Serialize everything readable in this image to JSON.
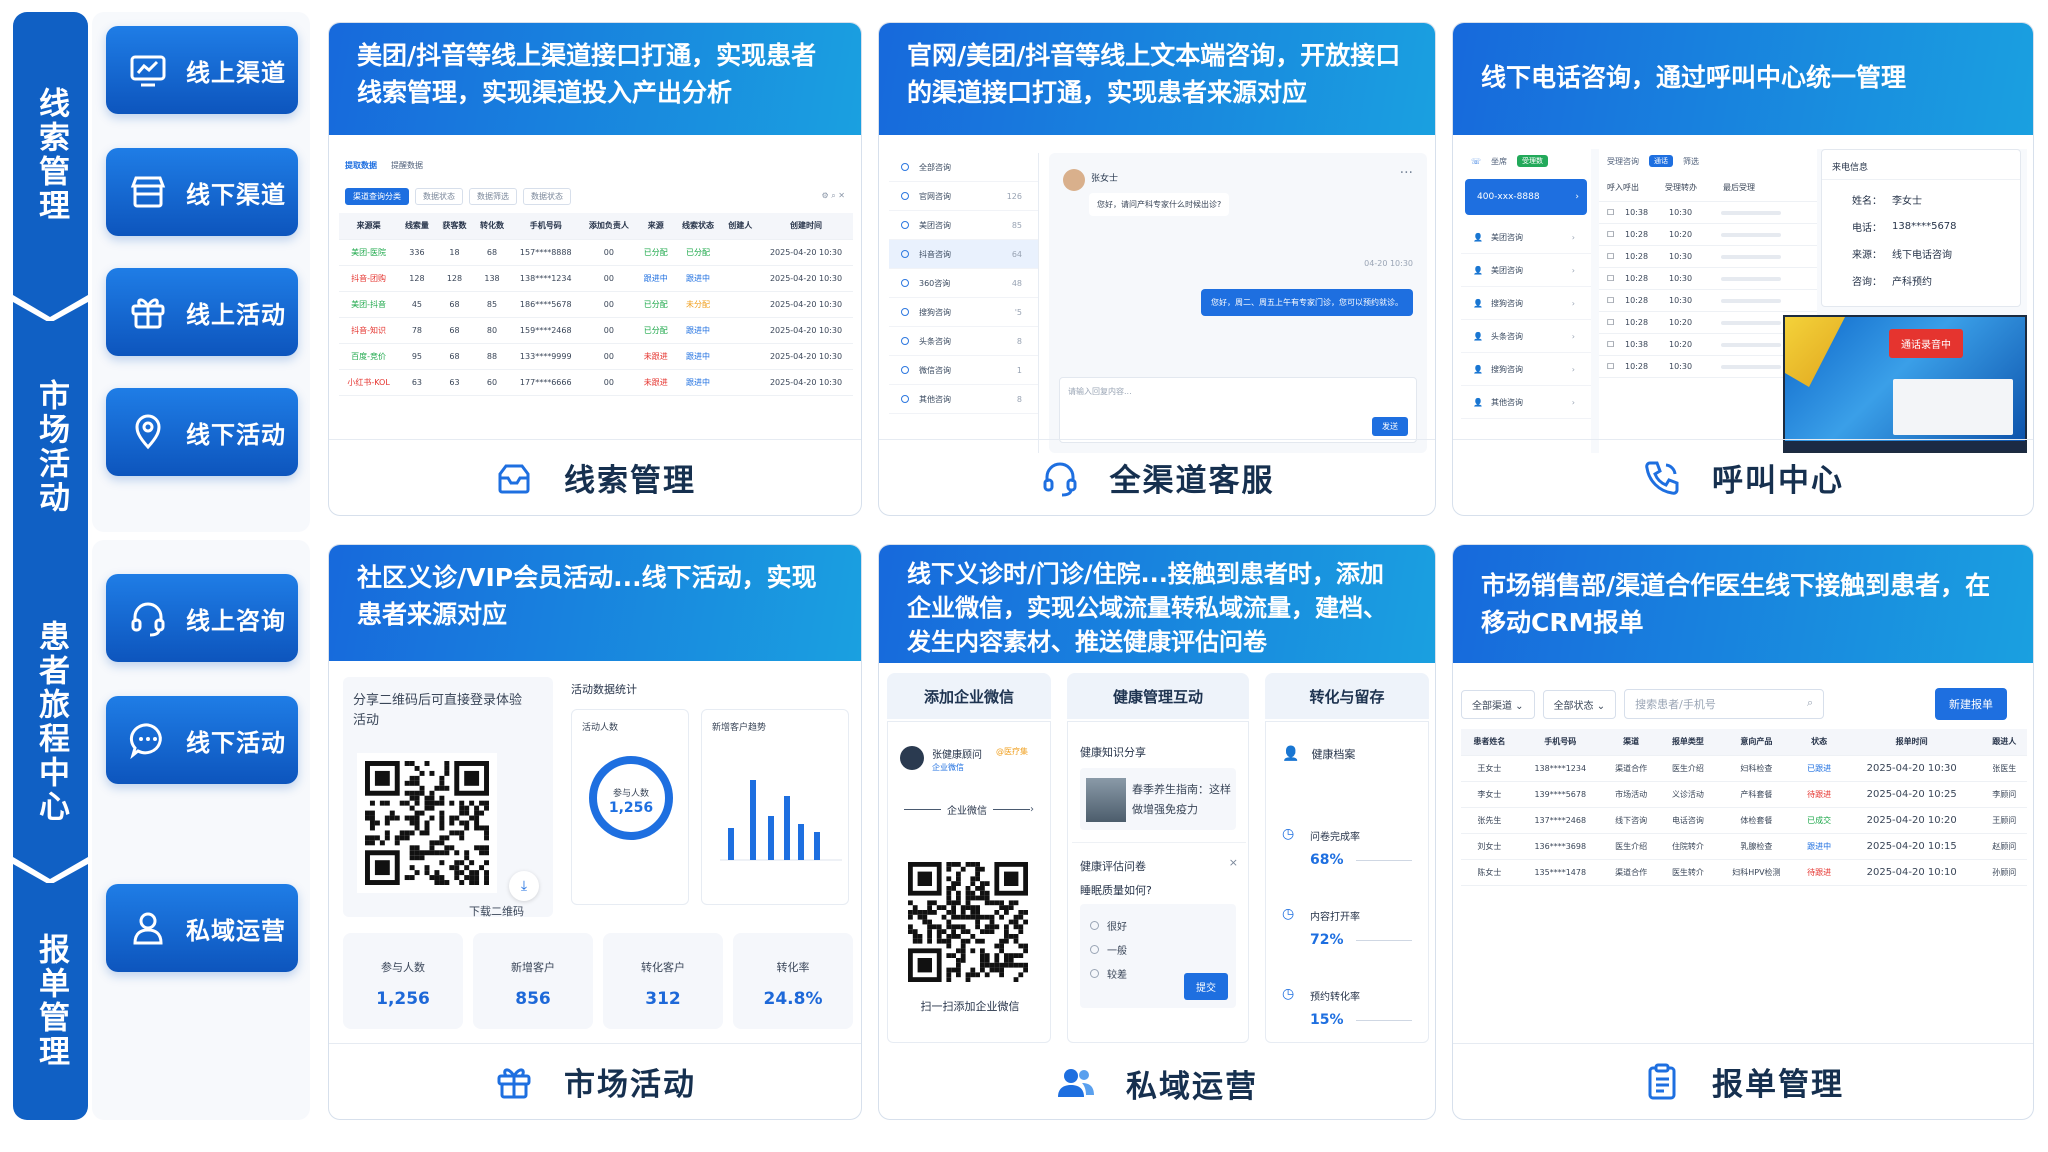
{
  "sidebar": {
    "segments": [
      "线索管理",
      "市场活动",
      "患者旅程中心",
      "报单管理"
    ],
    "items": [
      {
        "label": "线上渠道",
        "icon": "chart-monitor-icon"
      },
      {
        "label": "线下渠道",
        "icon": "store-icon"
      },
      {
        "label": "线上活动",
        "icon": "gift-icon"
      },
      {
        "label": "线下活动",
        "icon": "location-pin-icon"
      },
      {
        "label": "线上咨询",
        "icon": "headset-icon"
      },
      {
        "label": "线下活动",
        "icon": "chat-bubble-icon"
      },
      {
        "label": "私域运营",
        "icon": "user-icon"
      }
    ]
  },
  "cards": {
    "clue": {
      "banner": "美团/抖音等线上渠道接口打通，实现患者线索管理，实现渠道投入产出分析",
      "footer": "线索管理",
      "tabs_top": [
        "提取数据",
        "提醒数据"
      ],
      "filters": [
        "渠道查询分类",
        "数据状态",
        "数据筛选",
        "数据状态"
      ],
      "columns": [
        "来源渠",
        "线索量",
        "获客数",
        "转化数",
        "手机号码",
        "添加负责人",
        "来源",
        "线索状态",
        "创建人",
        "创建时间"
      ],
      "rows": [
        [
          "美团-医院",
          "336",
          "18",
          "68",
          "157****8888",
          "00",
          "已分配",
          "已分配",
          "",
          "2025-04-20 10:30"
        ],
        [
          "抖音-团购",
          "128",
          "128",
          "138",
          "138****1234",
          "00",
          "跟进中",
          "跟进中",
          "",
          "2025-04-20 10:30"
        ],
        [
          "美团-抖音",
          "45",
          "68",
          "85",
          "186****5678",
          "00",
          "已分配",
          "未分配",
          "",
          "2025-04-20 10:30"
        ],
        [
          "抖音-知识",
          "78",
          "68",
          "80",
          "159****2468",
          "00",
          "已分配",
          "跟进中",
          "",
          "2025-04-20 10:30"
        ],
        [
          "百度-竞价",
          "95",
          "68",
          "88",
          "133****9999",
          "00",
          "未跟进",
          "跟进中",
          "",
          "2025-04-20 10:30"
        ],
        [
          "小红书-KOL",
          "63",
          "63",
          "60",
          "177****6666",
          "00",
          "未跟进",
          "跟进中",
          "",
          "2025-04-20 10:30"
        ]
      ]
    },
    "service": {
      "banner": "官网/美团/抖音等线上文本端咨询，开放接口的渠道接口打通，实现患者来源对应",
      "footer": "全渠道客服",
      "list": [
        {
          "name": "全部咨询",
          "count": ""
        },
        {
          "name": "官网咨询",
          "count": "126"
        },
        {
          "name": "美团咨询",
          "count": "85"
        },
        {
          "name": "抖音咨询",
          "count": "64"
        },
        {
          "name": "360咨询",
          "count": "48"
        },
        {
          "name": "搜狗咨询",
          "count": "'5"
        },
        {
          "name": "头条咨询",
          "count": "8"
        },
        {
          "name": "微信咨询",
          "count": "1"
        },
        {
          "name": "其他咨询",
          "count": "8"
        }
      ],
      "chat_name": "张女士",
      "chat_msg1": "您好，请问产科专家什么时候出诊?",
      "chat_time1": "04-20 10:30",
      "chat_msg2": "您好，周二、周五上午有专家门诊，您可以预约就诊。",
      "chat_placeholder": "请输入回复内容...",
      "send": "发送"
    },
    "call": {
      "banner": "线下电话咨询，通过呼叫中心统一管理",
      "footer": "呼叫中心",
      "left_tabs": [
        "坐席",
        "受理数"
      ],
      "line": "400-xxx-8888",
      "side_items": [
        "美团咨询",
        "美团咨询",
        "搜狗咨询",
        "头条咨询",
        "搜狗咨询",
        "其他咨询"
      ],
      "mid_tabs": [
        "受理咨询",
        "通话",
        "筛选"
      ],
      "mid_headers": [
        "呼入呼出",
        "受理转办",
        "最后受理"
      ],
      "mid_rows": [
        [
          "10:38",
          "10:30"
        ],
        [
          "10:28",
          "10:20"
        ],
        [
          "10:28",
          "10:30"
        ],
        [
          "10:28",
          "10:30"
        ],
        [
          "10:28",
          "10:30"
        ],
        [
          "10:28",
          "10:20"
        ],
        [
          "10:38",
          "10:20"
        ],
        [
          "10:28",
          "10:30"
        ]
      ],
      "info_title": "来电信息",
      "info": [
        [
          "姓名：",
          "李女士"
        ],
        [
          "电话：",
          "138****5678"
        ],
        [
          "来源：",
          "线下电话咨询"
        ],
        [
          "咨询：",
          "产科预约"
        ]
      ],
      "record": "通话录音中"
    },
    "activity": {
      "banner": "社区义诊/VIP会员活动...线下活动，实现患者来源对应",
      "footer": "市场活动",
      "share_text": "分享二维码后可直接登录体验活动",
      "download": "下载二维码",
      "stats_title": "活动数据统计",
      "ring_title": "活动人数",
      "ring_label": "参与人数",
      "ring_value": "1,256",
      "trend_title": "新增客户趋势",
      "kpis": [
        {
          "k": "参与人数",
          "v": "1,256"
        },
        {
          "k": "新增客户",
          "v": "856"
        },
        {
          "k": "转化客户",
          "v": "312"
        },
        {
          "k": "转化率",
          "v": "24.8%"
        }
      ]
    },
    "private": {
      "banner": "线下义诊时/门诊/住院...接触到患者时，添加企业微信，实现公域流量转私域流量，建档、发生内容素材、推送健康评估问卷",
      "footer": "私域运营",
      "cols": [
        "添加企业微信",
        "健康管理互动",
        "转化与留存"
      ],
      "wx_name": "张健康顾问",
      "wx_tag": "@医疗集",
      "wx_sub": "企业微信",
      "wx_mid": "企业微信",
      "wx_scan": "扫一扫添加企业微信",
      "knowledge_title": "健康知识分享",
      "knowledge_text": "春季养生指南：这样做增强免疫力",
      "survey_title": "健康评估问卷",
      "survey_q": "睡眠质量如何?",
      "survey_opts": [
        "很好",
        "一般",
        "较差"
      ],
      "survey_submit": "提交",
      "record": "健康档案",
      "metrics": [
        {
          "k": "问卷完成率",
          "v": "68%"
        },
        {
          "k": "内容打开率",
          "v": "72%"
        },
        {
          "k": "预约转化率",
          "v": "15%"
        }
      ]
    },
    "report": {
      "banner": "市场销售部/渠道合作医生线下接触到患者，在移动CRM报单",
      "footer": "报单管理",
      "filters": [
        "全部渠道",
        "全部状态"
      ],
      "search_placeholder": "搜索患者/手机号",
      "new_btn": "新建报单",
      "columns": [
        "患者姓名",
        "手机号码",
        "渠道",
        "报单类型",
        "意向产品",
        "状态",
        "报单时间",
        "跟进人"
      ],
      "rows": [
        [
          "王女士",
          "138****1234",
          "渠道合作",
          "医生介绍",
          "妇科检查",
          "已跟进",
          "2025-04-20 10:30",
          "张医生"
        ],
        [
          "李女士",
          "139****5678",
          "市场活动",
          "义诊活动",
          "产科套餐",
          "待跟进",
          "2025-04-20 10:25",
          "李顾问"
        ],
        [
          "张先生",
          "137****2468",
          "线下咨询",
          "电话咨询",
          "体检套餐",
          "已成交",
          "2025-04-20 10:20",
          "王顾问"
        ],
        [
          "刘女士",
          "136****3698",
          "医生介绍",
          "住院转介",
          "乳腺检查",
          "跟进中",
          "2025-04-20 10:15",
          "赵顾问"
        ],
        [
          "陈女士",
          "135****1478",
          "渠道合作",
          "医生转介",
          "妇科HPV检测",
          "待跟进",
          "2025-04-20 10:10",
          "孙顾问"
        ]
      ]
    }
  },
  "colors": {
    "brand": "#1060c4",
    "accent": "#1e6fe0",
    "green": "#1ea84b",
    "red": "#e5342f",
    "orange": "#f0a020"
  }
}
